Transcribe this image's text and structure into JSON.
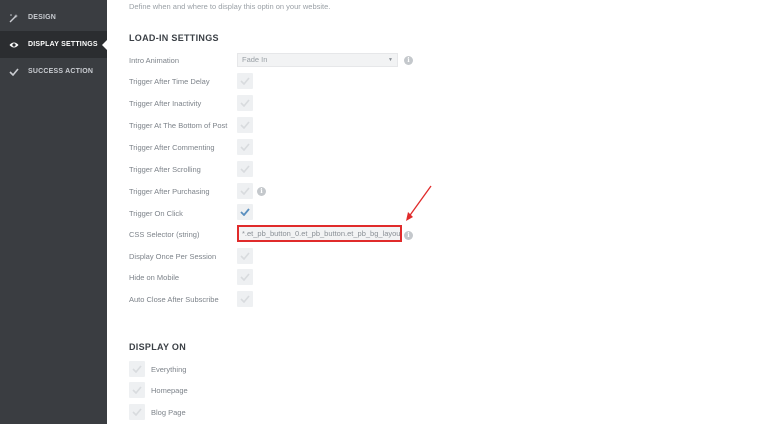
{
  "sidebar": {
    "items": [
      {
        "label": "DESIGN",
        "icon": "wand-icon"
      },
      {
        "label": "DISPLAY SETTINGS",
        "icon": "eye-icon"
      },
      {
        "label": "SUCCESS ACTION",
        "icon": "check-icon"
      }
    ]
  },
  "main": {
    "description": "Define when and where to display this optin on your website.",
    "loadin_title": "LOAD-IN SETTINGS",
    "intro_animation": {
      "label": "Intro Animation",
      "value": "Fade In"
    },
    "triggers": [
      {
        "label": "Trigger After Time Delay",
        "checked": false
      },
      {
        "label": "Trigger After Inactivity",
        "checked": false
      },
      {
        "label": "Trigger At The Bottom of Post",
        "checked": false
      },
      {
        "label": "Trigger After Commenting",
        "checked": false
      },
      {
        "label": "Trigger After Scrolling",
        "checked": false
      },
      {
        "label": "Trigger After Purchasing",
        "checked": false
      },
      {
        "label": "Trigger On Click",
        "checked": true
      }
    ],
    "css_selector": {
      "label": "CSS Selector (string)",
      "value": "*.et_pb_button_0.et_pb_button.et_pb_bg_layout_light"
    },
    "after_css": [
      {
        "label": "Display Once Per Session",
        "checked": false
      },
      {
        "label": "Hide on Mobile",
        "checked": false
      },
      {
        "label": "Auto Close After Subscribe",
        "checked": false
      }
    ],
    "display_on_title": "DISPLAY ON",
    "display_on": [
      {
        "label": "Everything",
        "checked": false
      },
      {
        "label": "Homepage",
        "checked": false
      },
      {
        "label": "Blog Page",
        "checked": false
      }
    ]
  },
  "colors": {
    "sidebar_bg": "#3a3d41",
    "sidebar_active_bg": "#2b2d30",
    "highlight_red": "#e02b2b",
    "checkmark_active": "#5a8fbf",
    "checkmark_inactive": "#d8dbde"
  }
}
